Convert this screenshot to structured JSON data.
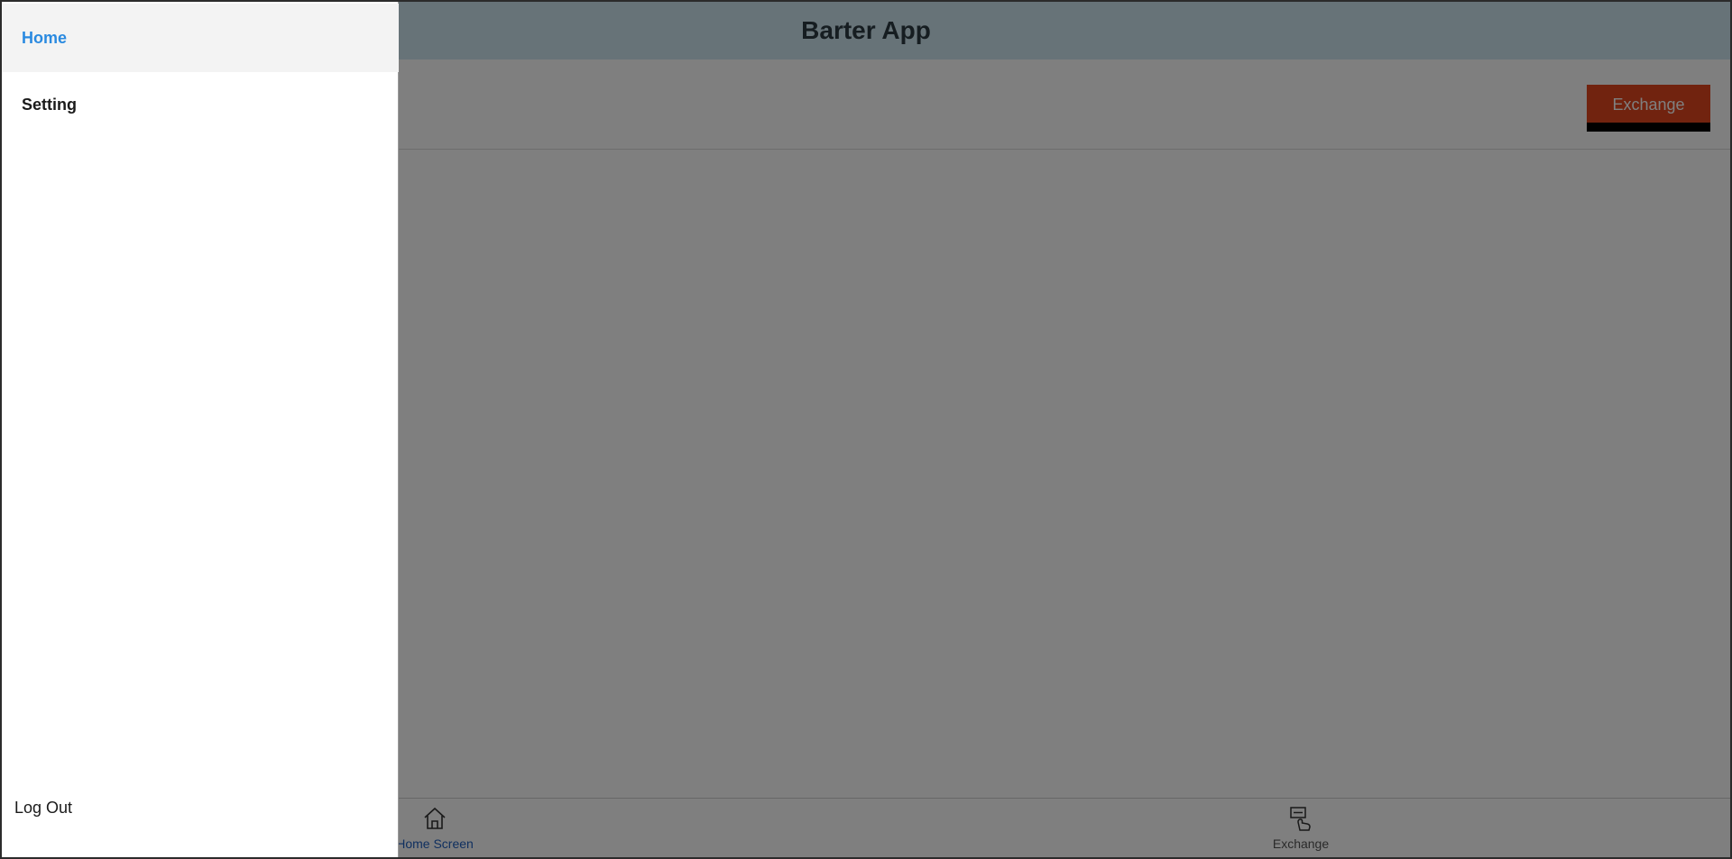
{
  "app": {
    "title": "Barter App"
  },
  "toolbar": {
    "exchange_label": "Exchange"
  },
  "bottom_nav": {
    "items": [
      {
        "label": "Home Screen",
        "icon": "home-icon"
      },
      {
        "label": "Exchange",
        "icon": "exchange-icon"
      }
    ]
  },
  "drawer": {
    "items": [
      {
        "label": "Home",
        "active": true
      },
      {
        "label": "Setting",
        "active": false
      }
    ],
    "logout_label": "Log Out"
  },
  "colors": {
    "accent": "#2a8ae0",
    "exchange_button": "#e2471f",
    "header": "#cfe6f0",
    "nav_active": "#1f5fbf"
  }
}
